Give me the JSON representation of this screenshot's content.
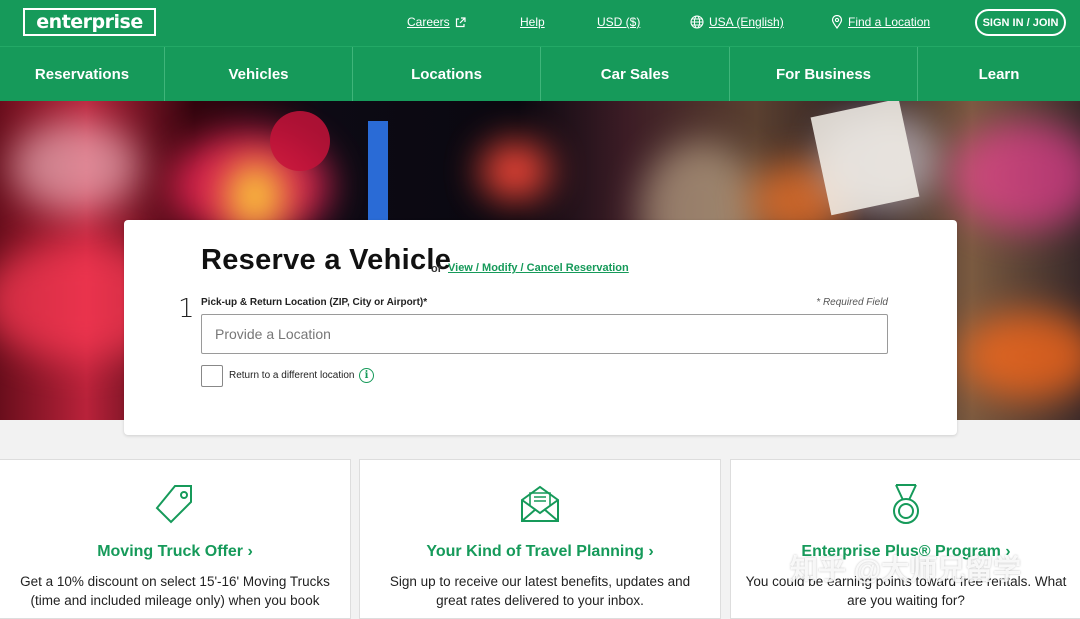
{
  "header": {
    "logo_text": "enterprise",
    "careers": "Careers",
    "help": "Help",
    "currency": "USD ($)",
    "region": "USA (English)",
    "find_location": "Find a Location",
    "sign_in": "SIGN IN / JOIN"
  },
  "nav": {
    "items": [
      {
        "label": "Reservations"
      },
      {
        "label": "Vehicles"
      },
      {
        "label": "Locations"
      },
      {
        "label": "Car Sales"
      },
      {
        "label": "For Business"
      },
      {
        "label": "Learn"
      }
    ]
  },
  "reserve": {
    "title": "Reserve a Vehicle",
    "or": "or",
    "view_link": "View / Modify / Cancel Reservation",
    "step": "1",
    "location_label": "Pick-up & Return Location (ZIP, City or Airport)*",
    "required_note": "* Required Field",
    "location_placeholder": "Provide a Location",
    "location_value": "",
    "return_label": "Return to a different location",
    "return_checked": false,
    "info_icon_glyph": "i"
  },
  "promos": [
    {
      "icon": "price-tag-icon",
      "title": "Moving Truck Offer",
      "text": "Get a 10% discount on select 15'-16' Moving Trucks (time and included mileage only) when you book"
    },
    {
      "icon": "envelope-letter-icon",
      "title": "Your Kind of Travel Planning",
      "text": "Sign up to receive our latest benefits, updates and great rates delivered to your inbox."
    },
    {
      "icon": "medal-icon",
      "title": "Enterprise Plus® Program",
      "text": "You could be earning points toward free rentals. What are you waiting for?"
    }
  ],
  "watermark": "知乎 @大师兄留学",
  "colors": {
    "brand_green": "#169a5a",
    "text_dark": "#111111",
    "page_bg": "#f2f2f2"
  }
}
